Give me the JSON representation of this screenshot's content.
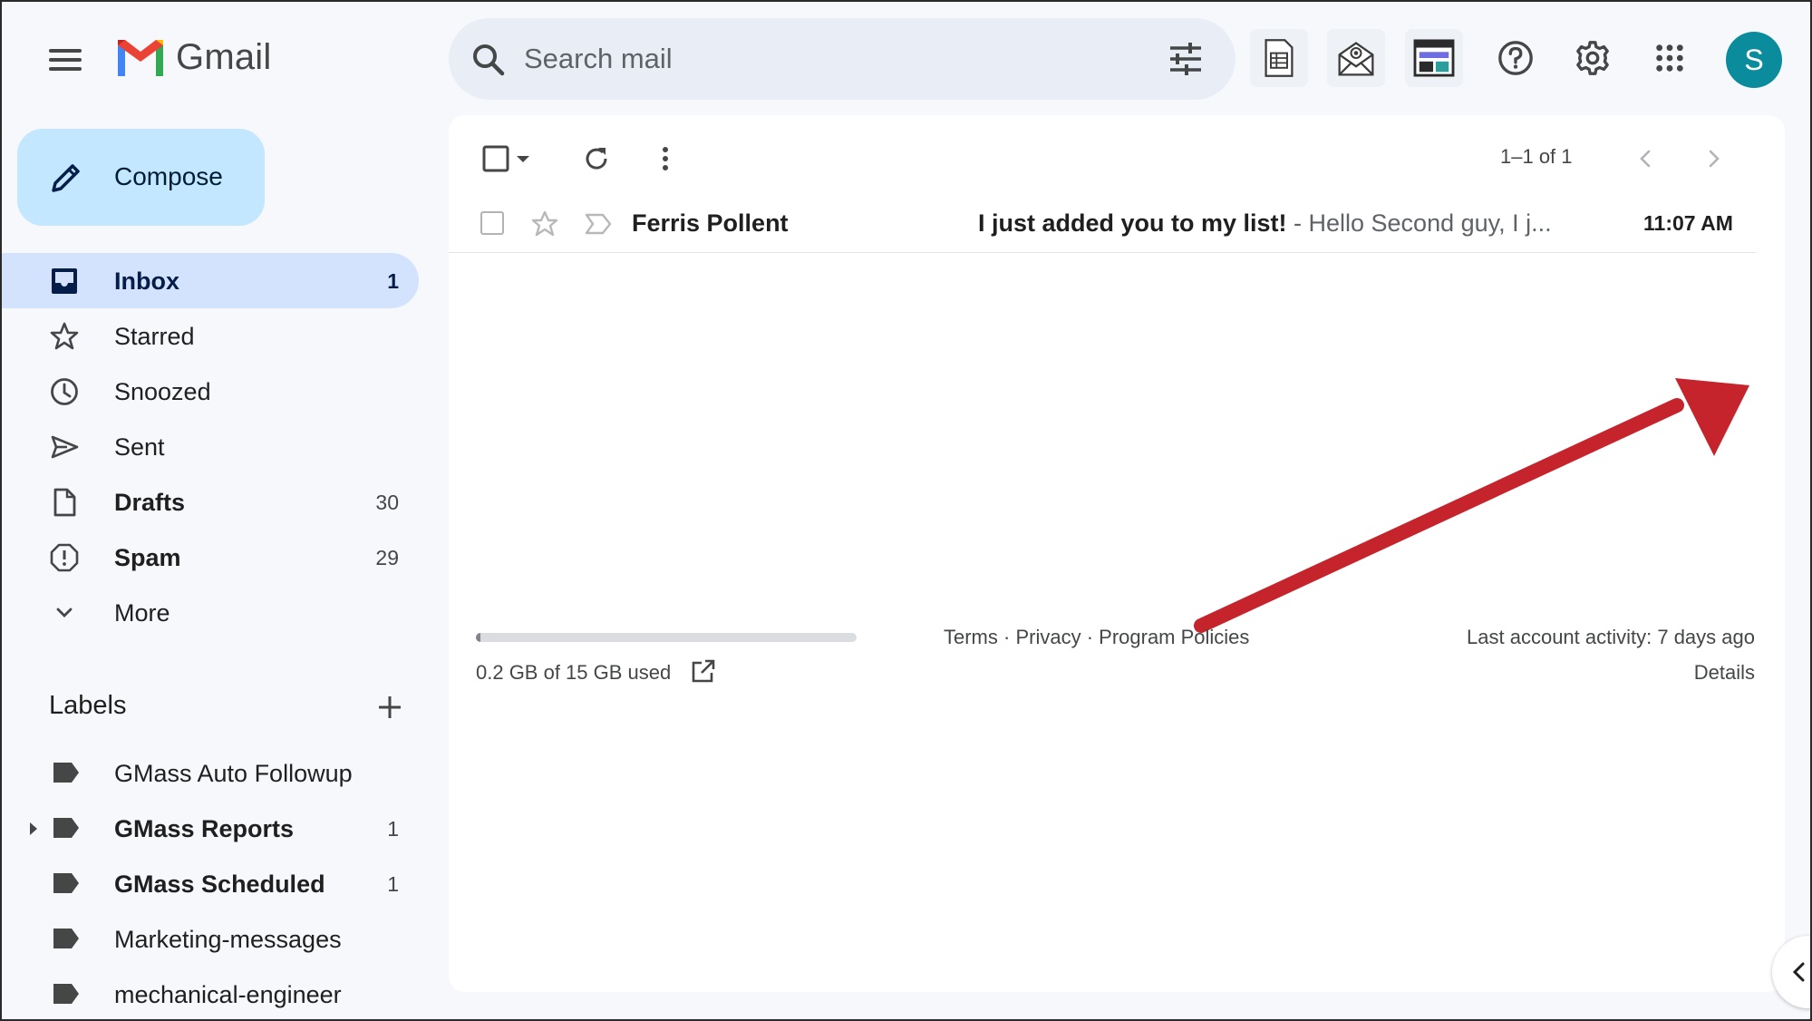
{
  "app": {
    "name": "Gmail",
    "avatar_letter": "S"
  },
  "search": {
    "placeholder": "Search mail"
  },
  "compose": {
    "label": "Compose"
  },
  "nav": [
    {
      "label": "Inbox",
      "count": "1",
      "icon": "inbox-icon",
      "active": true
    },
    {
      "label": "Starred",
      "count": "",
      "icon": "star-icon"
    },
    {
      "label": "Snoozed",
      "count": "",
      "icon": "clock-icon"
    },
    {
      "label": "Sent",
      "count": "",
      "icon": "send-icon"
    },
    {
      "label": "Drafts",
      "count": "30",
      "icon": "draft-icon"
    },
    {
      "label": "Spam",
      "count": "29",
      "icon": "spam-icon"
    },
    {
      "label": "More",
      "count": "",
      "icon": "chevron-down-icon"
    }
  ],
  "labels_section": {
    "title": "Labels",
    "items": [
      {
        "label": "GMass Auto Followup",
        "count": ""
      },
      {
        "label": "GMass Reports",
        "count": "1"
      },
      {
        "label": "GMass Scheduled",
        "count": "1"
      },
      {
        "label": "Marketing-messages",
        "count": ""
      },
      {
        "label": "mechanical-engineer",
        "count": ""
      }
    ]
  },
  "toolbar": {
    "pager": "1–1 of 1"
  },
  "messages": [
    {
      "sender": "Ferris Pollent",
      "subject": "I just added you to my list!",
      "snippet": " - Hello Second guy, I j...",
      "time": "11:07 AM"
    }
  ],
  "storage": {
    "used_fraction": 0.013,
    "text": "0.2 GB of 15 GB used"
  },
  "footer": {
    "terms": "Terms",
    "sep": " · ",
    "privacy": "Privacy",
    "policies": "Program Policies",
    "activity": "Last account activity: 7 days ago",
    "details": "Details"
  },
  "colors": {
    "accent": "#c2e7ff",
    "active_nav": "#d3e3fd",
    "avatar": "#0b8c9c",
    "annotation_arrow": "#c5242c"
  }
}
